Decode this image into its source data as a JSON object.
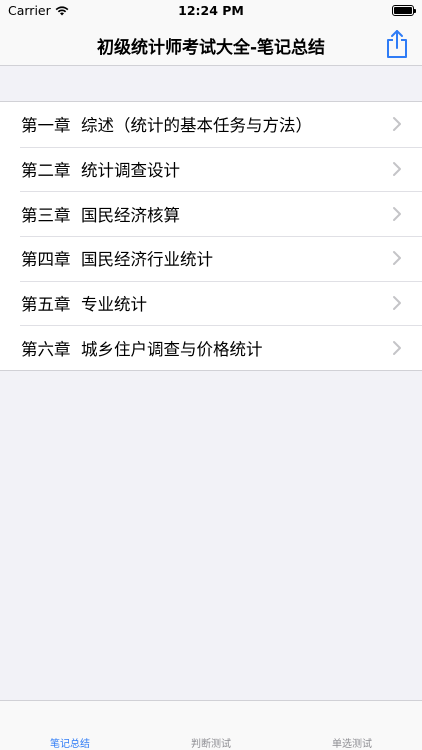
{
  "status_bar": {
    "carrier": "Carrier",
    "time": "12:24 PM",
    "battery_level": 1.0
  },
  "nav": {
    "title": "初级统计师考试大全-笔记总结",
    "share_icon": "share-icon"
  },
  "chapters": [
    {
      "label": "第一章  综述（统计的基本任务与方法）"
    },
    {
      "label": "第二章  统计调查设计"
    },
    {
      "label": "第三章  国民经济核算"
    },
    {
      "label": "第四章  国民经济行业统计"
    },
    {
      "label": "第五章  专业统计"
    },
    {
      "label": "第六章  城乡住户调查与价格统计"
    }
  ],
  "tabs": [
    {
      "label": "笔记总结",
      "active": true
    },
    {
      "label": "判断测试",
      "active": false
    },
    {
      "label": "单选测试",
      "active": false
    }
  ],
  "colors": {
    "accent": "#2f7cf6",
    "inactive_tab": "#8e8e93",
    "background": "#f2f2f7"
  }
}
